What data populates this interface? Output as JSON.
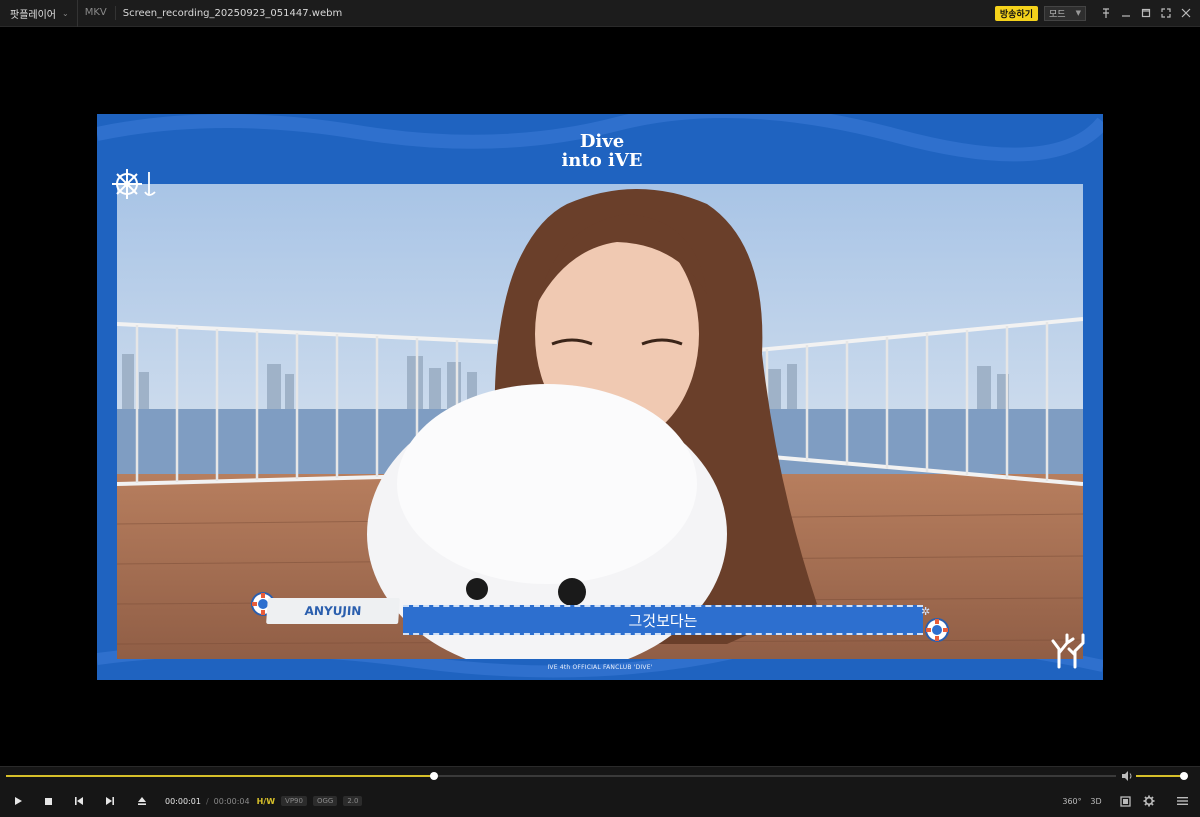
{
  "titlebar": {
    "app_name": "팟플레이어",
    "format": "MKV",
    "file_name": "Screen_recording_20250923_051447.webm",
    "broadcast_label": "방송하기",
    "mode_label": "모드"
  },
  "video": {
    "logo_line1": "Dive",
    "logo_line2": "into iVE",
    "speaker": "ANYUJIN",
    "subtitle": "그것보다는",
    "caption": "IVE 4th OFFICIAL FANCLUB 'DIVE'"
  },
  "controls": {
    "seek_progress": 0.386,
    "volume_level": 0.92,
    "time_current": "00:00:01",
    "time_separator": "/",
    "time_total": "00:00:04",
    "hw_label": "H/W",
    "video_codec": "VP90",
    "audio_codec": "OGG",
    "channels": "2.0",
    "btn_360": "360°",
    "btn_3d": "3D"
  },
  "colors": {
    "accent": "#d7c02a",
    "broadcast": "#f5d21b",
    "frame_blue": "#1f63c0"
  }
}
